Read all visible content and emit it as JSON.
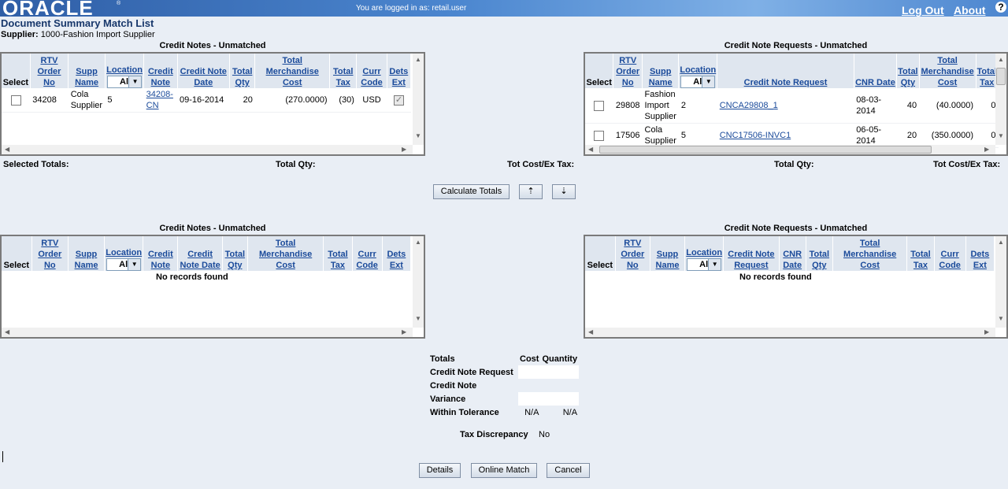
{
  "header": {
    "logo": "ORACLE",
    "logo_mark": "®",
    "login_text": "You are logged in as: retail.user",
    "logout": "Log Out",
    "about": "About",
    "help": "?"
  },
  "page": {
    "title": "Document Summary Match List",
    "supplier_label": "Supplier:",
    "supplier_value": "1000-Fashion Import Supplier"
  },
  "credit_notes_top": {
    "title": "Credit Notes - Unmatched",
    "columns": [
      "Select",
      "RTV Order No",
      "Supp Name",
      "Location",
      "Credit Note",
      "Credit Note Date",
      "Total Qty",
      "Total Merchandise Cost",
      "Total Tax",
      "Curr Code",
      "Dets Ext"
    ],
    "location_filter": "All",
    "rows": [
      {
        "rtv": "34208",
        "supp": "Cola Supplier",
        "location": "5",
        "credit_note": "34208-CN",
        "date": "09-16-2014",
        "qty": "20",
        "cost": "(270.0000)",
        "tax": "(30)",
        "curr": "USD"
      }
    ]
  },
  "cnr_top": {
    "title": "Credit Note Requests - Unmatched",
    "columns": [
      "Select",
      "RTV Order No",
      "Supp Name",
      "Location",
      "Credit Note Request",
      "CNR Date",
      "Total Qty",
      "Total Merchandise Cost",
      "Total Tax"
    ],
    "location_filter": "All",
    "rows": [
      {
        "rtv": "29808",
        "supp": "Fashion Import Supplier",
        "location": "2",
        "request": "CNCA29808_1",
        "date": "08-03-2014",
        "qty": "40",
        "cost": "(40.0000)",
        "tax": "0"
      },
      {
        "rtv": "17506",
        "supp": "Cola Supplier",
        "location": "5",
        "request": "CNC17506-INVC1",
        "date": "06-05-2014",
        "qty": "20",
        "cost": "(350.0000)",
        "tax": "0"
      }
    ]
  },
  "totals_bar": {
    "selected_totals": "Selected Totals:",
    "total_qty_left": "Total Qty:",
    "tot_cost_left": "Tot Cost/Ex Tax:",
    "total_qty_right": "Total Qty:",
    "tot_cost_right": "Tot Cost/Ex Tax:"
  },
  "buttons": {
    "calculate": "Calculate Totals",
    "up": "⇡",
    "down": "⇣",
    "details": "Details",
    "online_match": "Online Match",
    "cancel": "Cancel"
  },
  "credit_notes_bottom": {
    "title": "Credit Notes - Unmatched",
    "columns": [
      "Select",
      "RTV Order No",
      "Supp Name",
      "Location",
      "Credit Note",
      "Credit Note Date",
      "Total Qty",
      "Total Merchandise Cost",
      "Total Tax",
      "Curr Code",
      "Dets Ext"
    ],
    "location_filter": "All",
    "empty": "No records found"
  },
  "cnr_bottom": {
    "title": "Credit Note Requests - Unmatched",
    "columns": [
      "Select",
      "RTV Order No",
      "Supp Name",
      "Location",
      "Credit Note Request",
      "CNR Date",
      "Total Qty",
      "Total Merchandise Cost",
      "Total Tax",
      "Curr Code",
      "Dets Ext"
    ],
    "location_filter": "All",
    "empty": "No records found"
  },
  "summary": {
    "header_totals": "Totals",
    "header_cost": "Cost",
    "header_quantity": "Quantity",
    "row_cnr": "Credit Note Request",
    "row_cn": "Credit Note",
    "row_variance": "Variance",
    "row_tolerance": "Within Tolerance",
    "tolerance_cost": "N/A",
    "tolerance_qty": "N/A",
    "tax_discrepancy_label": "Tax Discrepancy",
    "tax_discrepancy_value": "No"
  }
}
